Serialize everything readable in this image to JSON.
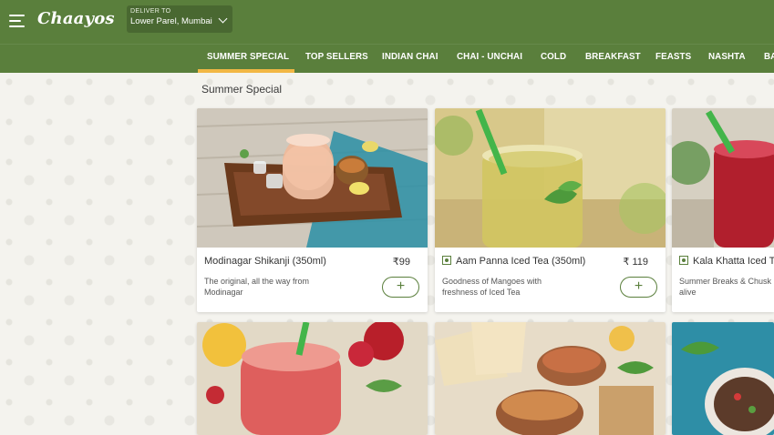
{
  "header": {
    "logo": "Chaayos",
    "deliver_label": "DELIVER TO",
    "location": "Lower Parel, Mumbai"
  },
  "categories": [
    "SUMMER SPECIAL",
    "TOP SELLERS",
    "INDIAN CHAI",
    "CHAI - UNCHAI",
    "COLD",
    "BREAKFAST",
    "FEASTS",
    "NASHTA",
    "BA"
  ],
  "active_category": "SUMMER SPECIAL",
  "section_title": "Summer Special",
  "products": [
    {
      "name": "Modinagar Shikanji (350ml)",
      "price": "₹99",
      "description": "The original, all the way from Modinagar",
      "veg_mark": false,
      "add_label": "+"
    },
    {
      "name": "Aam Panna Iced Tea (350ml)",
      "price": "₹ 119",
      "description": "Goodness of Mangoes with freshness of Iced Tea",
      "veg_mark": true,
      "add_label": "+"
    },
    {
      "name": "Kala Khatta Iced T",
      "price": "",
      "description": "Summer Breaks & Chusk alive",
      "veg_mark": true,
      "add_label": "+"
    }
  ],
  "colors": {
    "brand_green": "#5a7f3c",
    "accent_underline": "#f2b744",
    "page_background": "#f5f4ef"
  },
  "icons": [
    "menu-icon",
    "chevron-down-icon",
    "veg-indicator-icon",
    "plus-icon"
  ]
}
